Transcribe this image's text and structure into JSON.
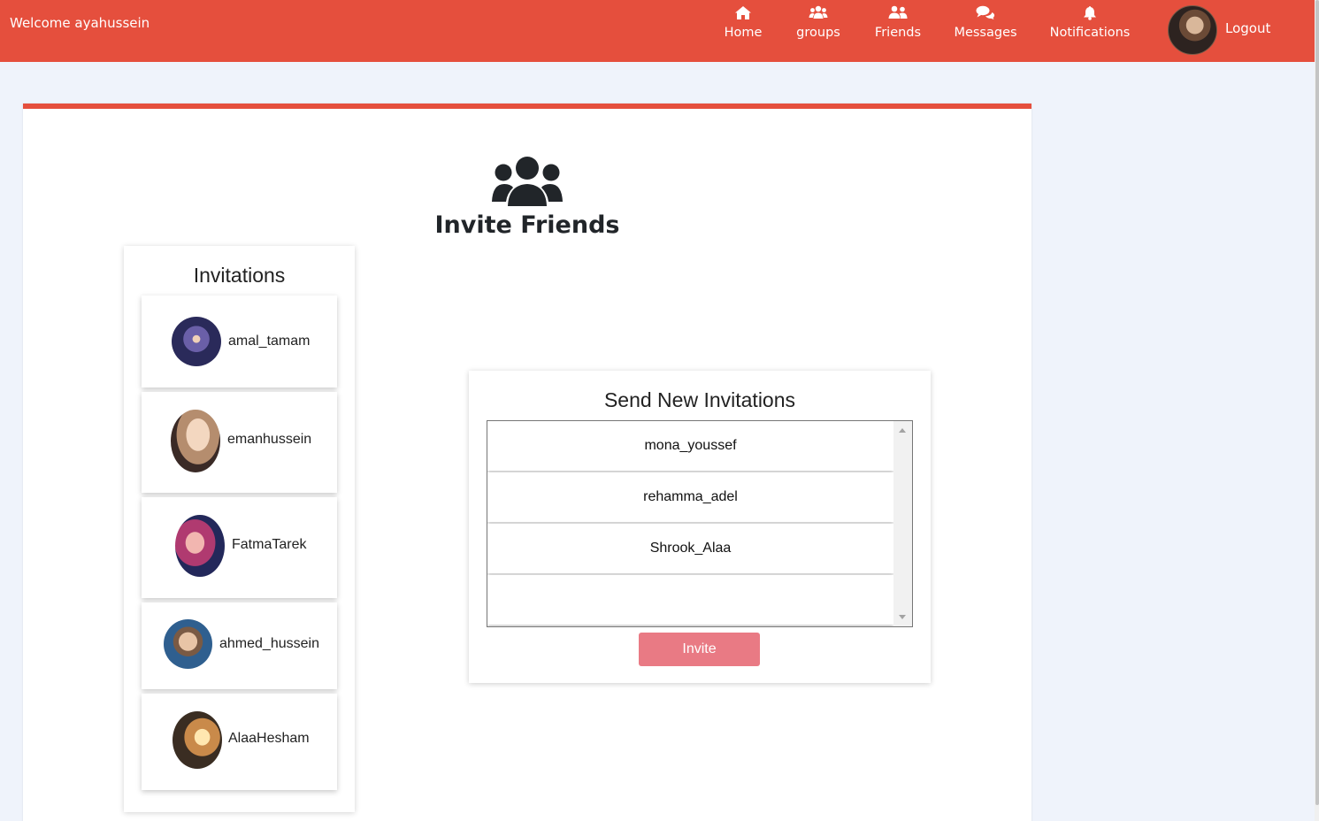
{
  "navbar": {
    "welcome": "Welcome ayahussein",
    "items": [
      {
        "label": "Home",
        "icon": "home-icon"
      },
      {
        "label": "groups",
        "icon": "users-icon"
      },
      {
        "label": "Friends",
        "icon": "user-friends-icon"
      },
      {
        "label": "Messages",
        "icon": "comments-icon"
      },
      {
        "label": "Notifications",
        "icon": "bell-icon"
      }
    ],
    "logout": "Logout"
  },
  "colors": {
    "brand": "#e54f3d",
    "background": "#eff3fb",
    "invite_button": "#e97a84"
  },
  "page": {
    "title": "Invite Friends",
    "title_icon": "users-icon"
  },
  "invitations": {
    "title": "Invitations",
    "items": [
      {
        "name": "amal_tamam"
      },
      {
        "name": "emanhussein"
      },
      {
        "name": "FatmaTarek"
      },
      {
        "name": "ahmed_hussein"
      },
      {
        "name": "AlaaHesham"
      }
    ]
  },
  "send": {
    "title": "Send New Invitations",
    "options": [
      "mona_youssef",
      "rehamma_adel",
      "Shrook_Alaa"
    ],
    "button": "Invite"
  }
}
